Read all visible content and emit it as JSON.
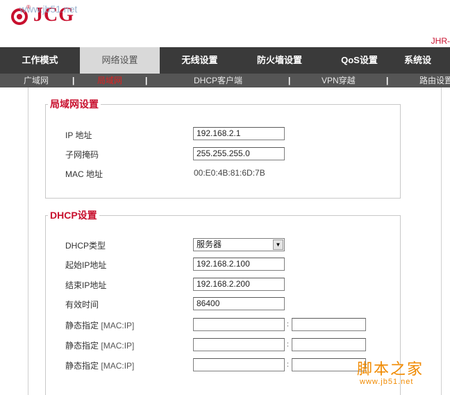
{
  "header": {
    "brand": "JCG",
    "watermark": "www.jb51.net",
    "model_partial": "JHR-"
  },
  "main_nav": [
    {
      "label": "工作模式"
    },
    {
      "label": "网络设置"
    },
    {
      "label": "无线设置"
    },
    {
      "label": "防火墙设置"
    },
    {
      "label": "QoS设置"
    },
    {
      "label": "系统设"
    }
  ],
  "sub_nav": {
    "items": [
      {
        "label": "广域网"
      },
      {
        "label": "局域网"
      },
      {
        "label": "DHCP客户端"
      },
      {
        "label": "VPN穿越"
      },
      {
        "label": "路由设置"
      }
    ],
    "separator": "|"
  },
  "lan": {
    "legend": "局域网设置",
    "ip_label": "IP 地址",
    "ip_value": "192.168.2.1",
    "mask_label": "子网掩码",
    "mask_value": "255.255.255.0",
    "mac_label": "MAC 地址",
    "mac_value": "00:E0:4B:81:6D:7B"
  },
  "dhcp": {
    "legend": "DHCP设置",
    "type_label": "DHCP类型",
    "type_value": "服务器",
    "start_label": "起始IP地址",
    "start_value": "192.168.2.100",
    "end_label": "结束IP地址",
    "end_value": "192.168.2.200",
    "lease_label": "有效时间",
    "lease_value": "86400",
    "static": [
      {
        "label": "静态指定",
        "hint": "[MAC:IP]",
        "mac": "",
        "ip": ""
      },
      {
        "label": "静态指定",
        "hint": "[MAC:IP]",
        "mac": "",
        "ip": ""
      },
      {
        "label": "静态指定",
        "hint": "[MAC:IP]",
        "mac": "",
        "ip": ""
      }
    ],
    "colon": ":"
  },
  "site_watermark": {
    "text": "脚本之家",
    "url": "www.jb51.net"
  },
  "colors": {
    "brand_red": "#c8102e",
    "nav_bg": "#3a3a3a",
    "subnav_bg": "#555555",
    "active_sub": "#e02020",
    "watermark_orange": "#f08a00"
  }
}
